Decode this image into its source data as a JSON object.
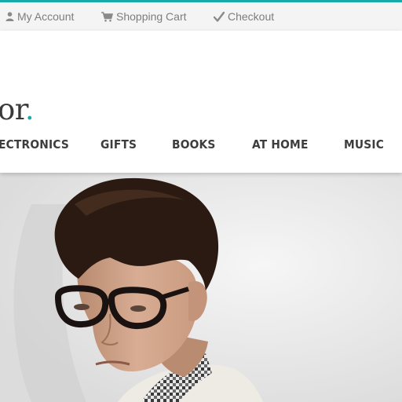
{
  "colors": {
    "accent": "#18a9a8",
    "topbar_bg": "#f4f4f4",
    "nav_text": "#3d3d3d",
    "top_link_text": "#7d7d7d"
  },
  "topbar": {
    "links": [
      {
        "label": "My Account",
        "icon": "user-icon"
      },
      {
        "label": "Shopping Cart",
        "icon": "cart-icon"
      },
      {
        "label": "Checkout",
        "icon": "checkmark-icon"
      }
    ]
  },
  "logo": {
    "text": "or",
    "dot": "."
  },
  "nav": {
    "items": [
      {
        "label": "ECTRONICS"
      },
      {
        "label": "GIFTS"
      },
      {
        "label": "BOOKS"
      },
      {
        "label": "AT HOME"
      },
      {
        "label": "MUSIC"
      }
    ]
  },
  "hero": {
    "image": "man-with-glasses-photo"
  }
}
